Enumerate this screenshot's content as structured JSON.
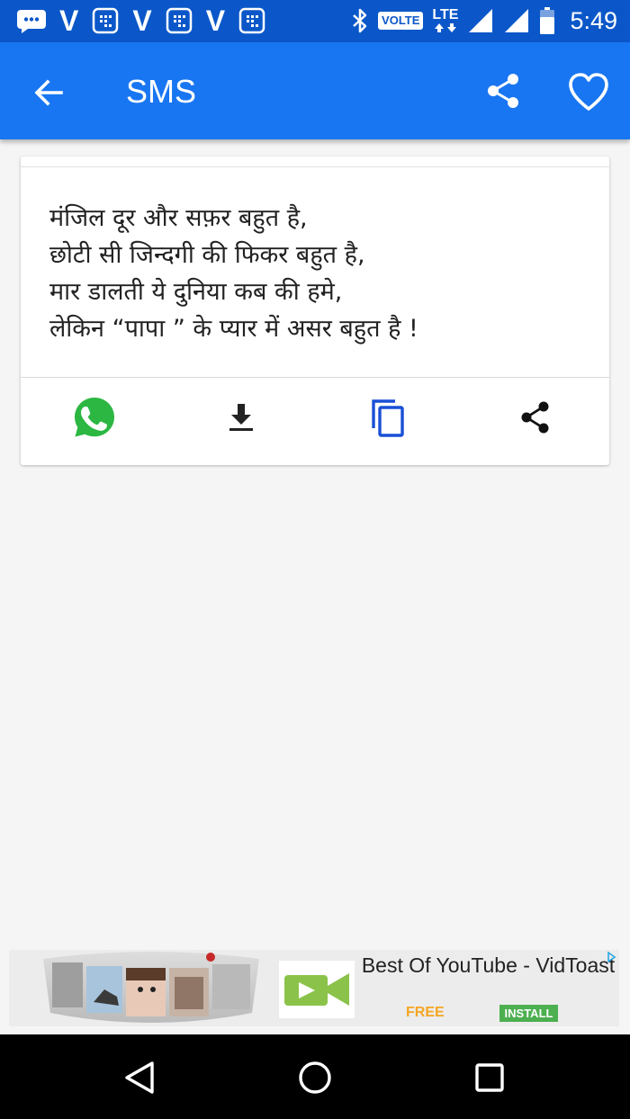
{
  "status_bar": {
    "time": "5:49",
    "carrier_letters": [
      "V",
      "V",
      "V"
    ],
    "volte_label": "VOLTE",
    "lte_label": "LTE",
    "icons": [
      "message-icon",
      "sim-icon",
      "bluetooth-icon",
      "signal-icon",
      "battery-icon"
    ]
  },
  "app_bar": {
    "title": "SMS",
    "icons": [
      "back-arrow-icon",
      "share-icon",
      "heart-icon"
    ]
  },
  "message": {
    "lines": [
      "मंजिल दूर और सफ़र बहुत है,",
      "छोटी सी जिन्दगी की फिकर बहुत है,",
      "मार डालती ये दुनिया कब की हमे,",
      "लेकिन “पापा ” के प्यार में असर बहुत है !"
    ],
    "actions": [
      "whatsapp-icon",
      "download-icon",
      "copy-icon",
      "share-icon"
    ]
  },
  "ad": {
    "title": "Best Of YouTube - VidToast",
    "free_label": "FREE",
    "install_label": "INSTALL"
  },
  "nav_bar": {
    "icons": [
      "back-triangle-icon",
      "home-circle-icon",
      "recents-square-icon"
    ]
  },
  "colors": {
    "status_bar": "#0b57c9",
    "app_bar": "#1976f2",
    "whatsapp_green": "#2cb742",
    "copy_blue": "#1a4fd6",
    "background": "#f5f5f5"
  }
}
